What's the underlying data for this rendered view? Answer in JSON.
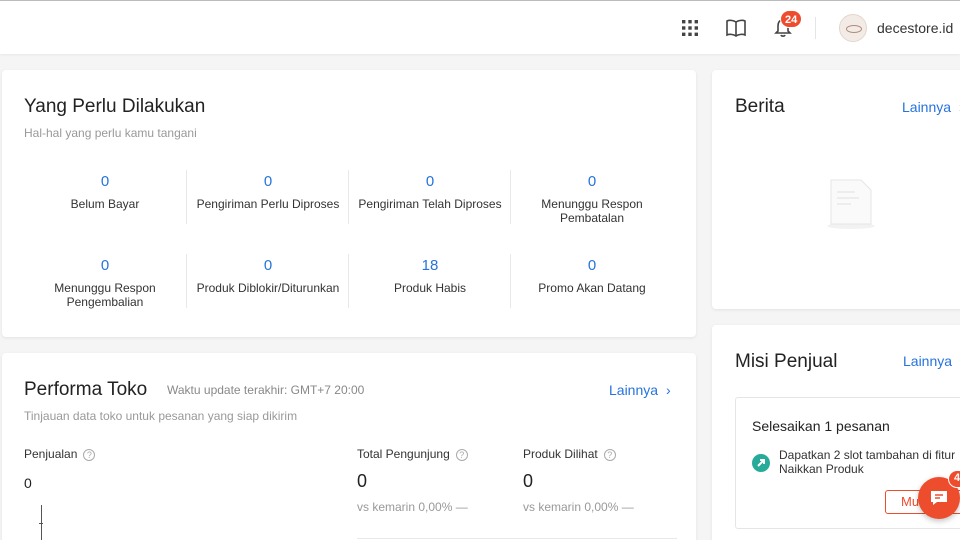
{
  "topbar": {
    "notification_count": "24",
    "shop_name": "decestore.id",
    "icons": [
      "apps-grid-icon",
      "book-icon",
      "bell-icon"
    ]
  },
  "todo": {
    "title": "Yang Perlu Dilakukan",
    "subtitle": "Hal-hal yang perlu kamu tangani",
    "items": [
      {
        "value": "0",
        "label": "Belum Bayar"
      },
      {
        "value": "0",
        "label": "Pengiriman Perlu Diproses"
      },
      {
        "value": "0",
        "label": "Pengiriman Telah Diproses"
      },
      {
        "value": "0",
        "label": "Menunggu Respon Pembatalan"
      },
      {
        "value": "0",
        "label": "Menunggu Respon Pengembalian"
      },
      {
        "value": "0",
        "label": "Produk Diblokir/Diturunkan"
      },
      {
        "value": "18",
        "label": "Produk Habis"
      },
      {
        "value": "0",
        "label": "Promo Akan Datang"
      }
    ]
  },
  "performa": {
    "title": "Performa Toko",
    "update_text": "Waktu update terakhir: GMT+7 20:00",
    "subtitle": "Tinjauan data toko untuk pesanan yang siap dikirim",
    "more_label": "Lainnya",
    "metrics": [
      {
        "label": "Penjualan",
        "value": "0",
        "vs": ""
      },
      {
        "label": "Total Pengunjung",
        "value": "0",
        "vs": "vs kemarin 0,00% —"
      },
      {
        "label": "Produk Dilihat",
        "value": "0",
        "vs": "vs kemarin 0,00% —"
      }
    ]
  },
  "berita": {
    "title": "Berita",
    "more_label": "Lainnya"
  },
  "misi": {
    "title": "Misi Penjual",
    "more_label": "Lainnya",
    "task_title": "Selesaikan 1 pesanan",
    "task_desc": "Dapatkan 2 slot tambahan di fitur Naikkan Produk",
    "button_label": "Mu"
  },
  "chat": {
    "badge": "4"
  },
  "colors": {
    "accent": "#ee4d2d",
    "link": "#2673dd",
    "mission_icon": "#26aa99"
  }
}
